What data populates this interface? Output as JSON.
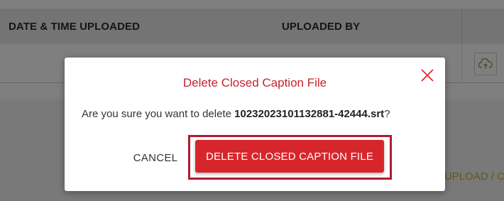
{
  "table": {
    "columns": [
      "DATE & TIME UPLOADED",
      "UPLOADED BY"
    ]
  },
  "background": {
    "upload_link_text": "UPLOAD / C"
  },
  "icons": {
    "upload": "cloud-upload-icon",
    "close": "close-icon"
  },
  "dialog": {
    "title": "Delete Closed Caption File",
    "message_prefix": "Are you sure you want to delete ",
    "filename": "10232023101132881-42444.srt",
    "message_suffix": "?",
    "cancel_label": "CANCEL",
    "confirm_label": "DELETE CLOSED CAPTION FILE"
  },
  "colors": {
    "accent_red": "#d7262b",
    "title_red": "#c4242b",
    "highlight_border": "#b01b2f"
  }
}
